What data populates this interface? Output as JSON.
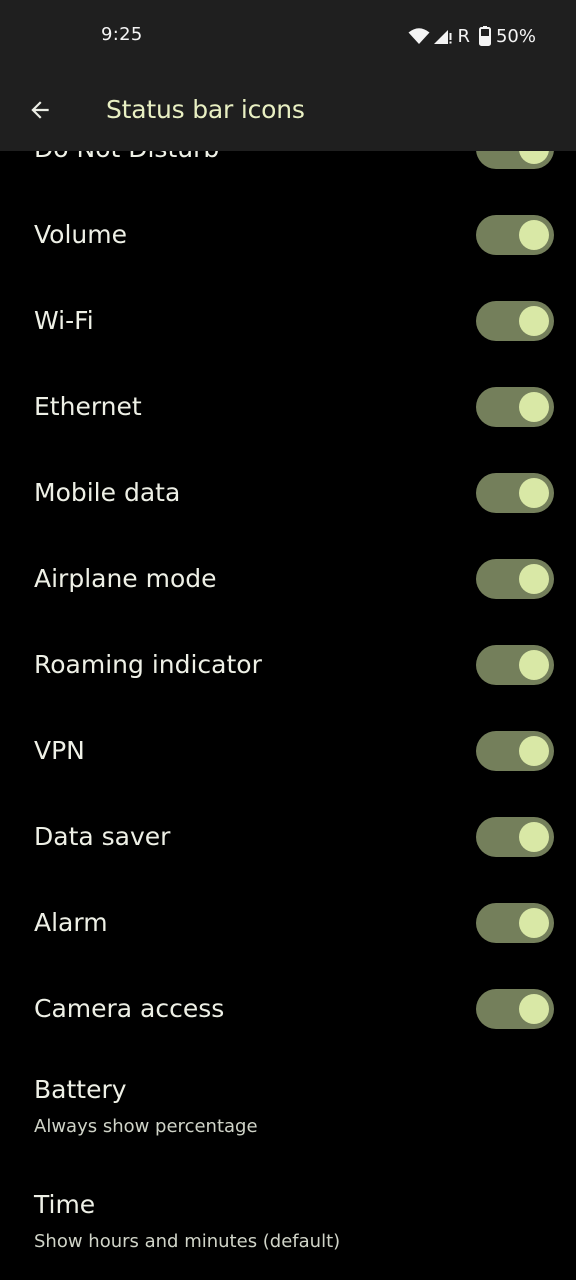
{
  "status_bar": {
    "time": "9:25",
    "roaming_label": "R",
    "battery_percent": "50%",
    "icons": [
      "wifi-icon",
      "cell-signal-icon",
      "battery-icon"
    ]
  },
  "app_bar": {
    "back_icon": "arrow-back-icon",
    "title": "Status bar icons"
  },
  "colors": {
    "bar_background": "#1f1f1f",
    "title": "#e9f0c3",
    "toggle_track_on": "#747f5b",
    "toggle_thumb_on": "#d9e8a6"
  },
  "toggles": [
    {
      "label": "Do Not Disturb",
      "on": true
    },
    {
      "label": "Volume",
      "on": true
    },
    {
      "label": "Wi-Fi",
      "on": true
    },
    {
      "label": "Ethernet",
      "on": true
    },
    {
      "label": "Mobile data",
      "on": true
    },
    {
      "label": "Airplane mode",
      "on": true
    },
    {
      "label": "Roaming indicator",
      "on": true
    },
    {
      "label": "VPN",
      "on": true
    },
    {
      "label": "Data saver",
      "on": true
    },
    {
      "label": "Alarm",
      "on": true
    },
    {
      "label": "Camera access",
      "on": true
    }
  ],
  "preferences": [
    {
      "title": "Battery",
      "summary": "Always show percentage"
    },
    {
      "title": "Time",
      "summary": "Show hours and minutes (default)"
    }
  ]
}
